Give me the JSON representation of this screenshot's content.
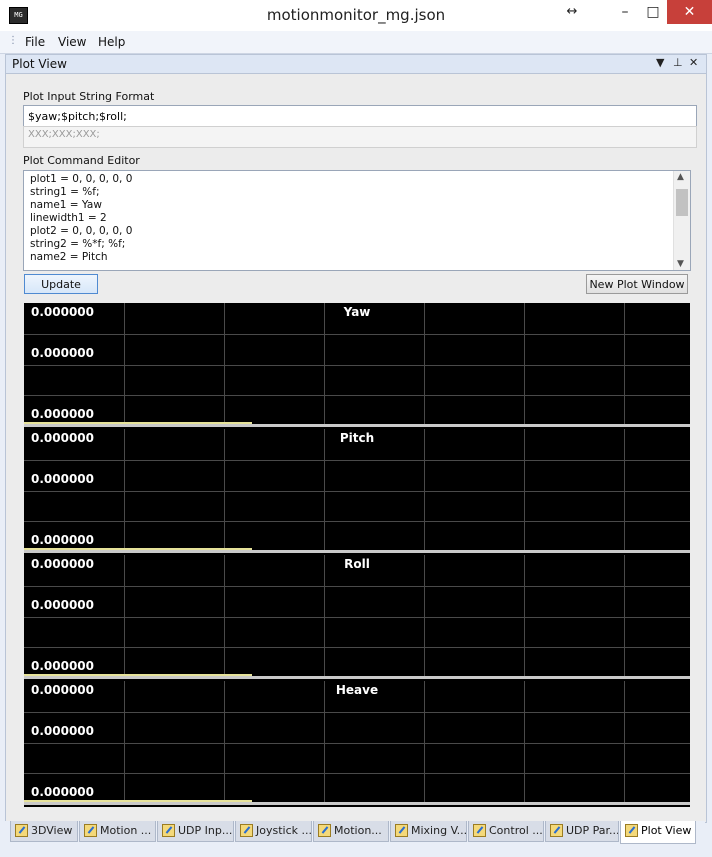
{
  "window": {
    "title": "motionmonitor_mg.json",
    "icon_text": "MG",
    "resize_glyph": "↔",
    "minimize_glyph": "–",
    "maximize_glyph": "□",
    "close_glyph": "✕"
  },
  "menu": {
    "grip": "⋮",
    "items": [
      "File",
      "View",
      "Help"
    ]
  },
  "panel": {
    "title": "Plot View",
    "dropdown_glyph": "▼",
    "pin_glyph": "⊥",
    "close_glyph": "✕",
    "format_label": "Plot Input String Format",
    "format_value": "$yaw;$pitch;$roll;",
    "format_preview": "XXX;XXX;XXX;",
    "editor_label": "Plot Command Editor",
    "editor_lines": [
      "plot1 = 0, 0, 0, 0, 0",
      "string1 = %f;",
      "name1 = Yaw",
      "linewidth1 = 2",
      "plot2 = 0, 0, 0, 0, 0",
      "string2 = %*f; %f;",
      "name2 = Pitch"
    ],
    "scroll_up": "▲",
    "scroll_down": "▼",
    "update_label": "Update",
    "new_plot_label": "New Plot Window"
  },
  "plots": [
    {
      "title": "Yaw",
      "values": [
        "0.000000",
        "0.000000",
        "0.000000"
      ]
    },
    {
      "title": "Pitch",
      "values": [
        "0.000000",
        "0.000000",
        "0.000000"
      ]
    },
    {
      "title": "Roll",
      "values": [
        "0.000000",
        "0.000000",
        "0.000000"
      ]
    },
    {
      "title": "Heave",
      "values": [
        "0.000000",
        "0.000000",
        "0.000000"
      ]
    }
  ],
  "tabs": [
    {
      "label": "3DView",
      "active": false
    },
    {
      "label": "Motion ...",
      "active": false
    },
    {
      "label": "UDP Inp...",
      "active": false
    },
    {
      "label": "Joystick ...",
      "active": false
    },
    {
      "label": "Motion...",
      "active": false
    },
    {
      "label": "Mixing V...",
      "active": false
    },
    {
      "label": "Control ...",
      "active": false
    },
    {
      "label": "UDP Par...",
      "active": false
    },
    {
      "label": "Plot View",
      "active": true
    }
  ],
  "colors": {
    "plot_bg": "#000000",
    "grid": "#4a4a4a",
    "trace": "#e6e29a",
    "close_btn": "#c7403a"
  }
}
